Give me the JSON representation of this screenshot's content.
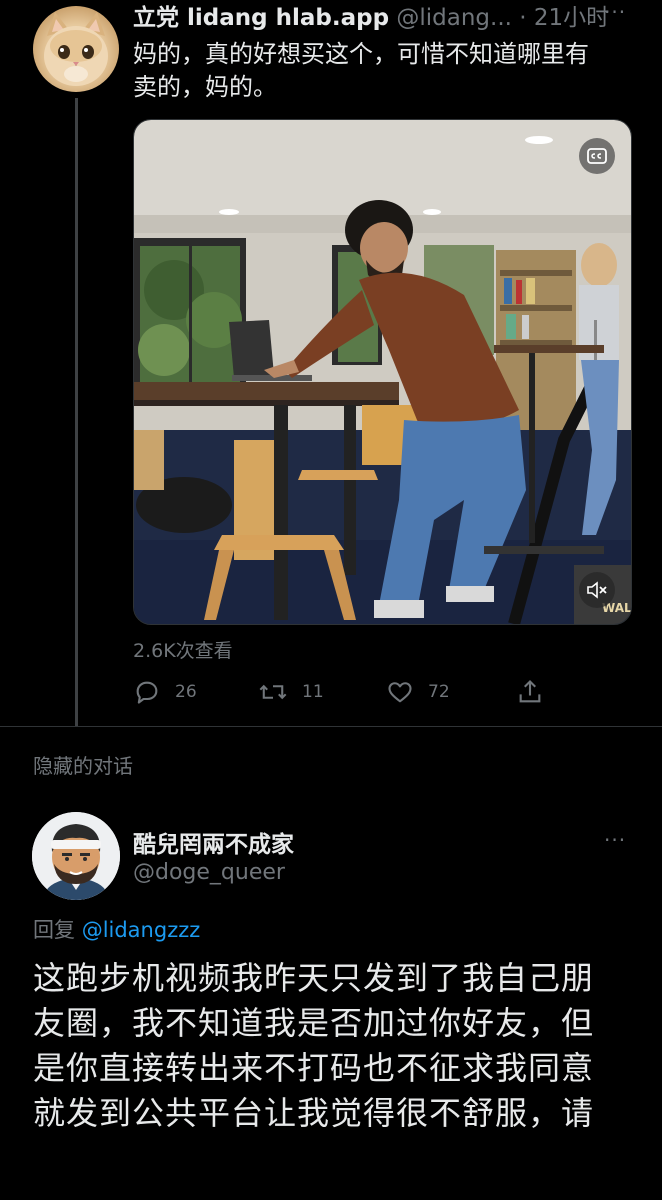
{
  "tweet1": {
    "display_name": "立党 lidang hlab.app",
    "handle_time": "@lidang... · 21小时",
    "text_line1": "妈的，真的好想买这个，可惜不知道哪里有",
    "text_line2": "卖的，妈的。",
    "more_label": "···",
    "views": "2.6K次查看",
    "actions": {
      "replies": "26",
      "retweets": "11",
      "likes": "72"
    },
    "video_watermark": "WAL"
  },
  "hidden_conversation": "隐藏的对话",
  "tweet2": {
    "display_name": "酷兒罔兩不成家",
    "handle": "@doge_queer",
    "more_label": "···",
    "reply_prefix": "回复",
    "reply_mention": "@lidangzzz",
    "text_lines": [
      "这跑步机视频我昨天只发到了我自己朋",
      "友圈，我不知道我是否加过你好友，但",
      "是你直接转出来不打码也不征求我同意",
      "就发到公共平台让我觉得很不舒服，请"
    ]
  },
  "icons": {
    "reply": "speech-bubble-icon",
    "retweet": "retweet-arrows-icon",
    "like": "heart-icon",
    "share": "share-upload-icon",
    "captions": "captions-icon",
    "mute": "speaker-muted-icon"
  },
  "colors": {
    "background": "#000000",
    "text_primary": "#e7e9ea",
    "text_secondary": "#71767b",
    "link": "#1d9bf0",
    "divider": "#2f3336"
  }
}
